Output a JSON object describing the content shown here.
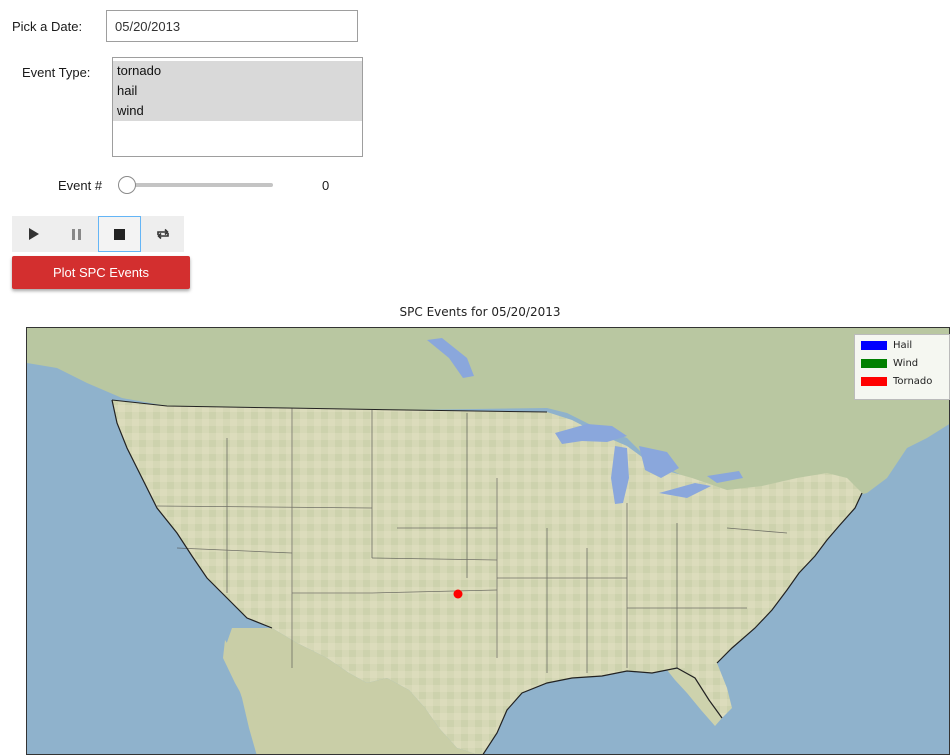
{
  "date_picker": {
    "label": "Pick a Date:",
    "value": "05/20/2013"
  },
  "event_type": {
    "label": "Event Type:",
    "options": [
      "tornado",
      "hail",
      "wind"
    ]
  },
  "event_slider": {
    "label": "Event #",
    "value": "0",
    "fraction": 0
  },
  "player": {
    "buttons": [
      {
        "icon": "play-icon"
      },
      {
        "icon": "pause-icon"
      },
      {
        "icon": "stop-icon"
      },
      {
        "icon": "repeat-icon"
      }
    ]
  },
  "plot_button": {
    "label": "Plot SPC Events"
  },
  "map": {
    "title": "SPC Events for 05/20/2013",
    "legend": [
      {
        "label": "Hail",
        "color": "#0000ff"
      },
      {
        "label": "Wind",
        "color": "#008000"
      },
      {
        "label": "Tornado",
        "color": "#ff0000"
      }
    ]
  },
  "colors": {
    "button": "#d32f2f",
    "ocean": "#8fb2cc",
    "land": "#d3d6b4",
    "lakes": "#8aa7dc",
    "event_marker": "#ff0000"
  }
}
